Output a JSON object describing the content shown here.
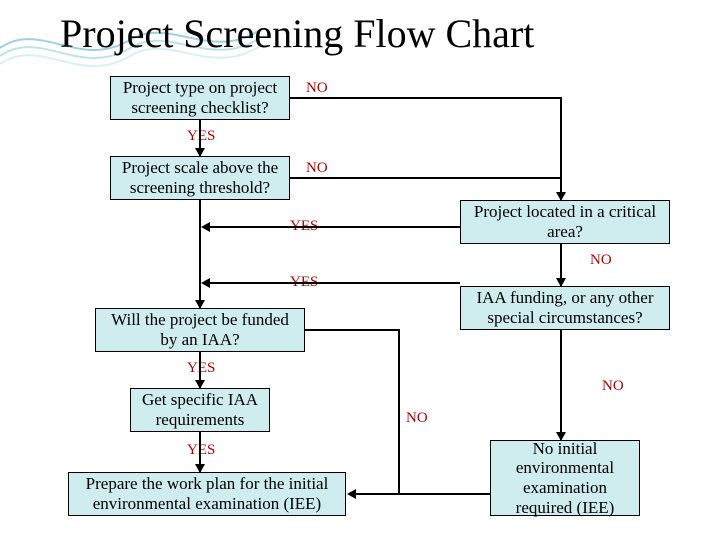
{
  "title": "Project Screening Flow Chart",
  "nodes": {
    "n1": "Project type on project screening checklist?",
    "n2": "Project scale above the screening threshold?",
    "n3": "Will the project be funded by an IAA?",
    "n4": "Get specific IAA requirements",
    "n5": "Prepare the work plan for the initial environmental examination (IEE)",
    "n6": "Project located in a critical area?",
    "n7": "IAA funding, or any other special circumstances?",
    "n8": "No initial environmental examination required (IEE)"
  },
  "labels": {
    "yes": "YES",
    "no": "NO"
  }
}
